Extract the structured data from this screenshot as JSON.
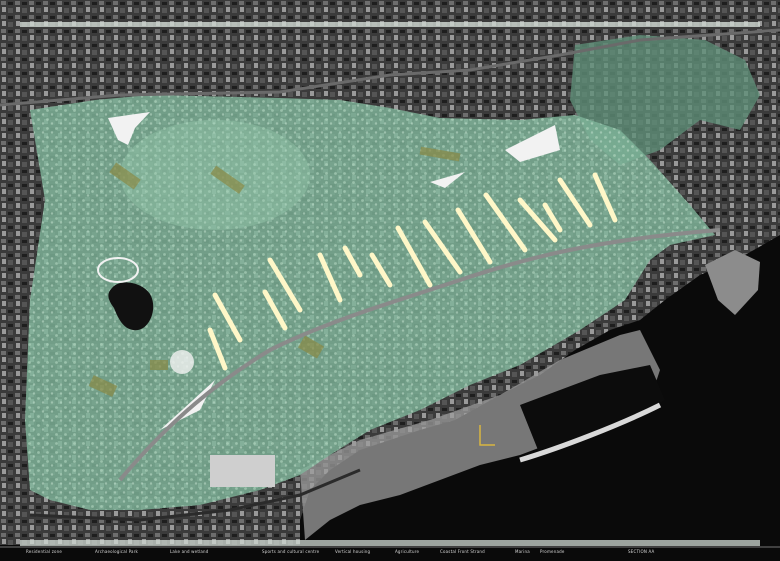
{
  "map": {
    "colors": {
      "sea": "#0a0a0a",
      "city": "#3a3a3a",
      "park": "#7fb59a",
      "park_dark": "#5f8f78",
      "lake": "#111111",
      "road": "#8a8a8a",
      "building_light": "#f2f2f2",
      "field_olive": "#8a8a45",
      "accent_yellow": "#d8b640"
    },
    "legend": {
      "labels": [
        "Residential zone",
        "Archaeological Park",
        "Lake and wetland",
        "Sports and cultural centre",
        "Vertical housing",
        "Agriculture",
        "Coastal Front Strand",
        "Marina",
        "Promenade",
        "SECTION AA"
      ]
    }
  }
}
